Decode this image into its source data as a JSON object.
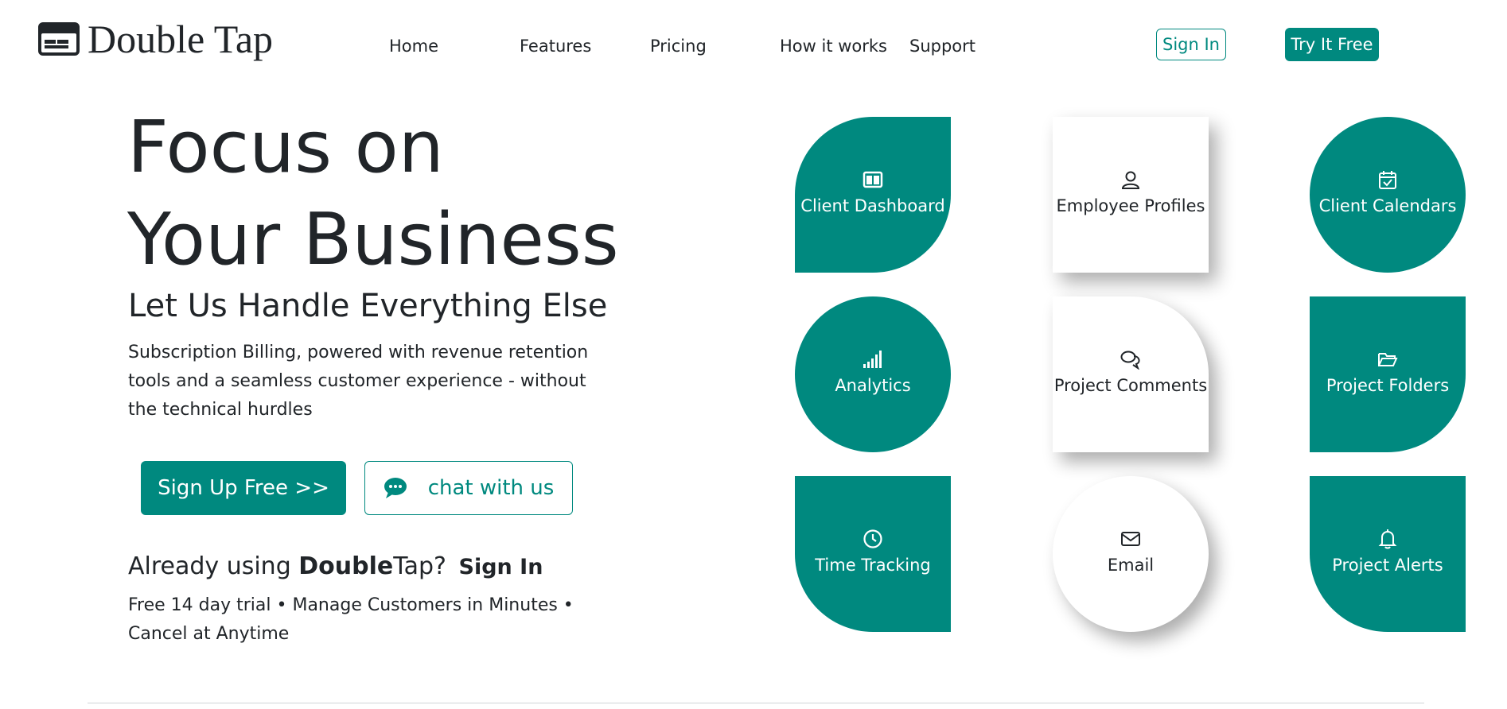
{
  "brand": {
    "name": "Double Tap",
    "accent": "#00897f"
  },
  "nav": {
    "items": [
      {
        "label": "Home"
      },
      {
        "label": "Features"
      },
      {
        "label": "Pricing"
      },
      {
        "label": "How it works"
      },
      {
        "label": "Support"
      }
    ],
    "signin_label": "Sign In",
    "try_label": "Try It Free"
  },
  "hero": {
    "title_line1": "Focus on",
    "title_line2": "Your Business",
    "subtitle": "Let Us Handle Everything Else",
    "description": "Subscription Billing, powered with revenue retention tools and a seamless customer experience - without the technical hurdles",
    "signup_label": "Sign Up Free >>",
    "chat_label": "chat with us",
    "already_prefix": "Already using ",
    "already_brand_bold": "Double",
    "already_brand_rest": "Tap?",
    "already_signin": "Sign In",
    "fine_print": "Free 14 day trial • Manage Customers in Minutes • Cancel at Anytime"
  },
  "features": [
    {
      "label": "Client Dashboard",
      "icon": "layout-icon"
    },
    {
      "label": "Employee Profiles",
      "icon": "person-icon"
    },
    {
      "label": "Client Calendars",
      "icon": "calendar-check-icon"
    },
    {
      "label": "Analytics",
      "icon": "signal-bars-icon"
    },
    {
      "label": "Project Comments",
      "icon": "chat-bubbles-icon"
    },
    {
      "label": "Project Folders",
      "icon": "folder-open-icon"
    },
    {
      "label": "Time Tracking",
      "icon": "clock-icon"
    },
    {
      "label": "Email",
      "icon": "envelope-icon"
    },
    {
      "label": "Project Alerts",
      "icon": "bell-icon"
    }
  ]
}
